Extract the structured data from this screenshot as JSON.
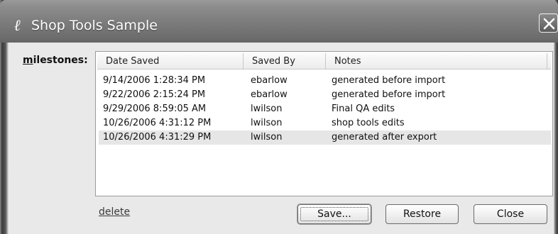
{
  "window": {
    "title": "Shop Tools Sample",
    "icon_glyph": "ℓ"
  },
  "milestones": {
    "label_accel": "m",
    "label_rest": "ilestones:",
    "columns": [
      "Date Saved",
      "Saved By",
      "Notes"
    ],
    "rows": [
      {
        "date": "9/14/2006 1:28:34 PM",
        "by": "ebarlow",
        "notes": "generated before import",
        "selected": false
      },
      {
        "date": "9/22/2006 2:15:24 PM",
        "by": "ebarlow",
        "notes": "generated before import",
        "selected": false
      },
      {
        "date": "9/29/2006 8:59:05 AM",
        "by": "lwilson",
        "notes": "Final QA edits",
        "selected": false
      },
      {
        "date": "10/26/2006 4:31:12 PM",
        "by": "lwilson",
        "notes": "shop tools edits",
        "selected": false
      },
      {
        "date": "10/26/2006 4:31:29 PM",
        "by": "lwilson",
        "notes": "generated after export",
        "selected": true
      }
    ]
  },
  "actions": {
    "delete_label": "delete",
    "save_label": "Save...",
    "restore_label": "Restore",
    "close_label": "Close"
  },
  "icons": {
    "app": "app-logo-icon",
    "close": "close-icon"
  },
  "colors": {
    "titlebar": "#7a7a7a",
    "selected_row": "#e6e6e6",
    "dialog_bg": "#e9e9e9"
  }
}
